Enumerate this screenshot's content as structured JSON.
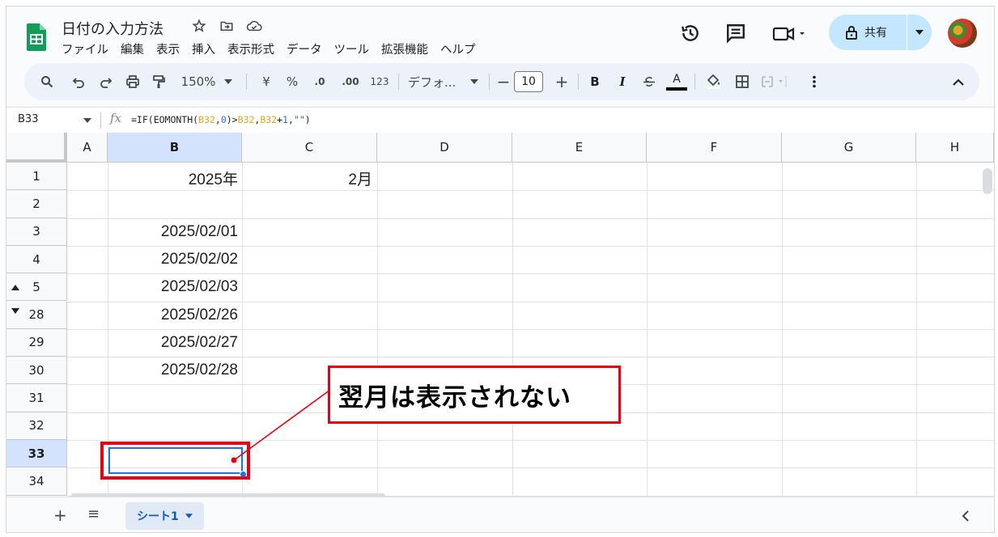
{
  "doc": {
    "title": "日付の入力方法"
  },
  "menu": [
    "ファイル",
    "編集",
    "表示",
    "挿入",
    "表示形式",
    "データ",
    "ツール",
    "拡張機能",
    "ヘルプ"
  ],
  "share": {
    "label": "共有"
  },
  "toolbar": {
    "zoom": "150%",
    "currency": "¥",
    "percent": "%",
    "dec_decrease": ".0",
    "dec_increase": ".00",
    "number_format": "123",
    "font": "デフォ...",
    "font_size": "10",
    "minus": "−",
    "plus": "+",
    "bold": "B",
    "italic": "I",
    "underline_a": "A"
  },
  "formula_bar": {
    "name_box": "B33",
    "fx": "fx",
    "formula_parts": [
      "=IF(EOMONTH(",
      "B32",
      ",",
      "0",
      ")>",
      "B32",
      ",",
      "B32",
      "+",
      "1",
      ",",
      "\"\"",
      ")"
    ]
  },
  "columns": [
    "A",
    "B",
    "C",
    "D",
    "E",
    "F",
    "G",
    "H"
  ],
  "rows": [
    {
      "num": "1",
      "B": "2025年",
      "C": "2月"
    },
    {
      "num": "2",
      "B": "",
      "C": ""
    },
    {
      "num": "3",
      "B": "2025/02/01",
      "C": ""
    },
    {
      "num": "4",
      "B": "2025/02/02",
      "C": ""
    },
    {
      "num": "5",
      "B": "2025/02/03",
      "C": ""
    },
    {
      "num": "28",
      "B": "2025/02/26",
      "C": ""
    },
    {
      "num": "29",
      "B": "2025/02/27",
      "C": ""
    },
    {
      "num": "30",
      "B": "2025/02/28",
      "C": ""
    },
    {
      "num": "31",
      "B": "",
      "C": ""
    },
    {
      "num": "32",
      "B": "",
      "C": ""
    },
    {
      "num": "33",
      "B": "",
      "C": ""
    },
    {
      "num": "34",
      "B": "",
      "C": ""
    }
  ],
  "selected": {
    "column": "B",
    "row": "33"
  },
  "annotation": {
    "text": "翌月は表示されない",
    "color": "#e50012"
  },
  "sheet_tabs": {
    "active": "シート1",
    "add": "+",
    "list": "≡"
  },
  "colors": {
    "accent": "#1a73e8",
    "share_bg": "#c2e7ff",
    "selected_header": "#d3e3fd",
    "sheets_green": "#0f9d58"
  }
}
